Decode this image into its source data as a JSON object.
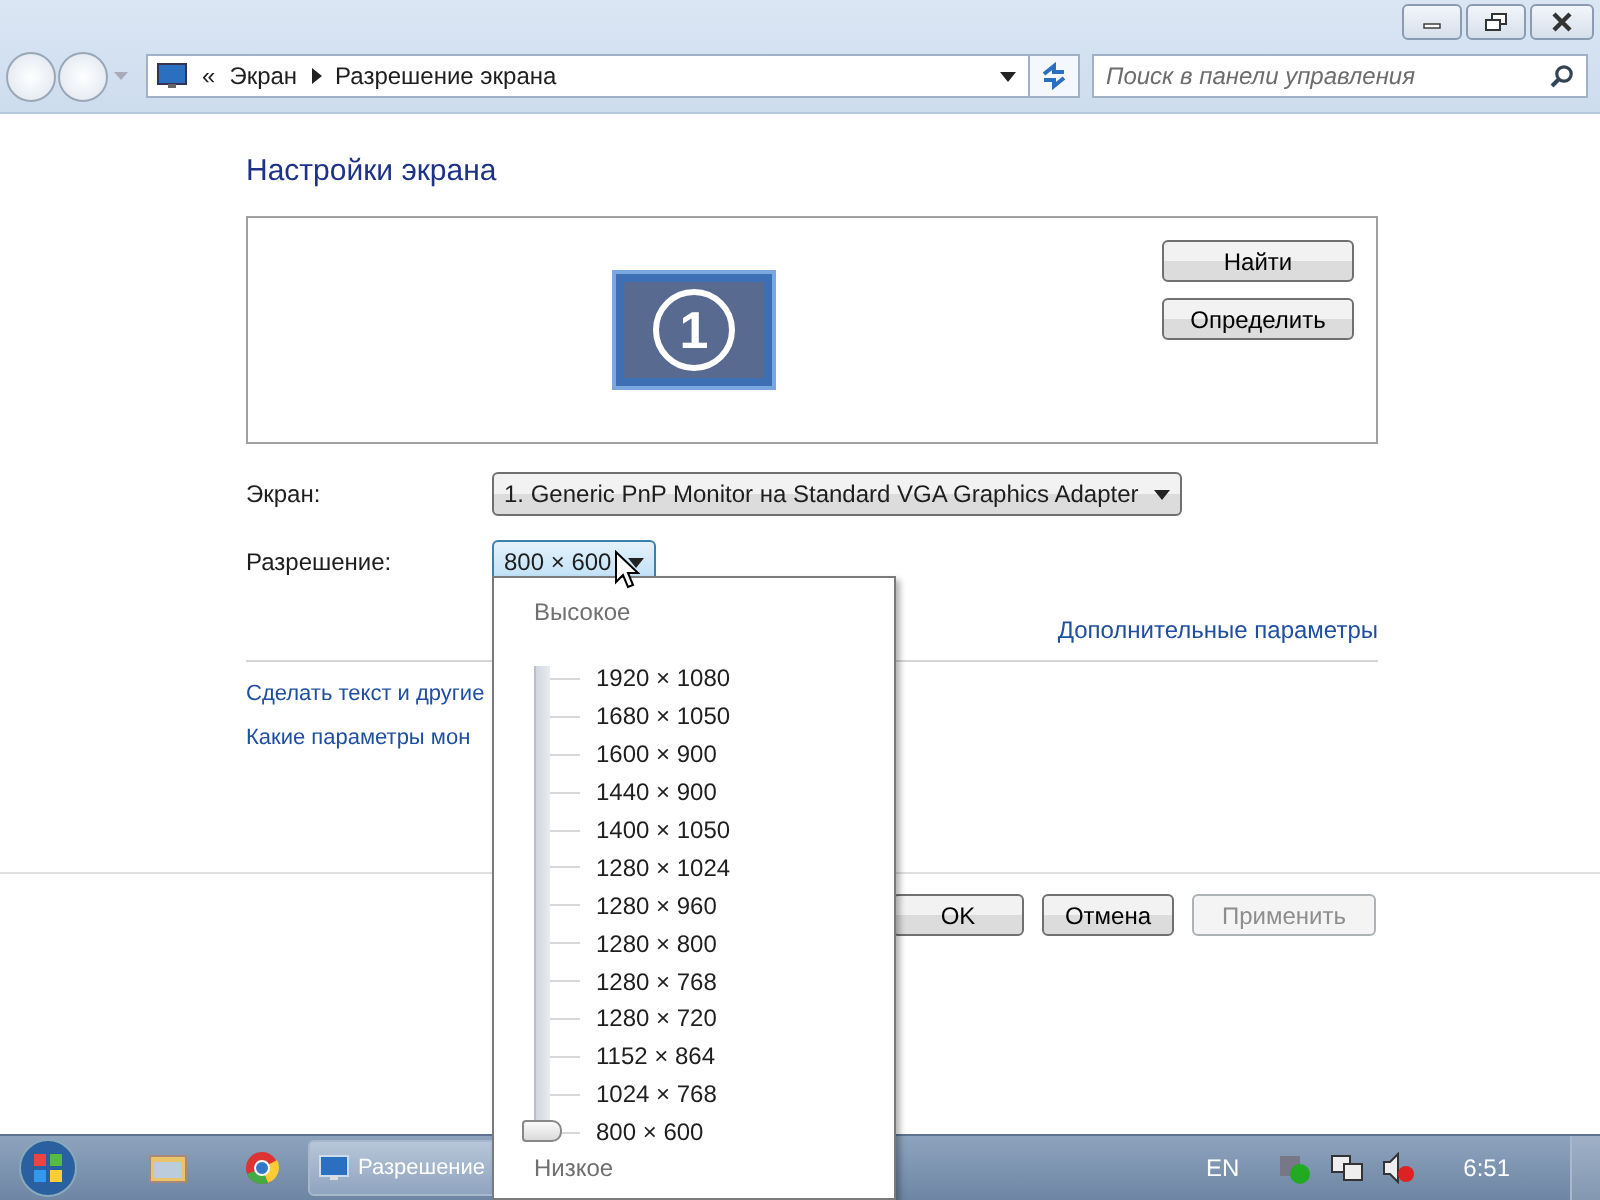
{
  "address_bar": {
    "overflow": "«",
    "crumbs": [
      "Экран",
      "Разрешение экрана"
    ]
  },
  "search": {
    "placeholder": "Поиск в панели управления"
  },
  "heading": "Настройки экрана",
  "preview": {
    "monitor_number": "1",
    "buttons": [
      "Найти",
      "Определить"
    ]
  },
  "fields": [
    {
      "label": "Экран:",
      "value": "1. Generic PnP Monitor на Standard VGA Graphics Adapter",
      "expanded": false
    },
    {
      "label": "Разрешение:",
      "value": "800 × 600",
      "expanded": true
    }
  ],
  "advanced_link": "Дополнительные параметры",
  "links": [
    "Сделать текст и другие",
    "Какие параметры мон"
  ],
  "dialog_buttons": [
    {
      "label": "OK",
      "disabled": false
    },
    {
      "label": "Отмена",
      "disabled": false
    },
    {
      "label": "Применить",
      "disabled": true
    }
  ],
  "resolution_popup": {
    "high_label": "Высокое",
    "low_label": "Низкое",
    "options": [
      "1920 × 1080",
      "1680 × 1050",
      "1600 × 900",
      "1440 × 900",
      "1400 × 1050",
      "1280 × 1024",
      "1280 × 960",
      "1280 × 800",
      "1280 × 768",
      "1280 × 720",
      "1152 × 864",
      "1024 × 768",
      "800 × 600"
    ],
    "slider": {
      "level": 0
    }
  },
  "taskbar": {
    "task": "Разрешение",
    "language": "EN",
    "time": "6:51"
  }
}
